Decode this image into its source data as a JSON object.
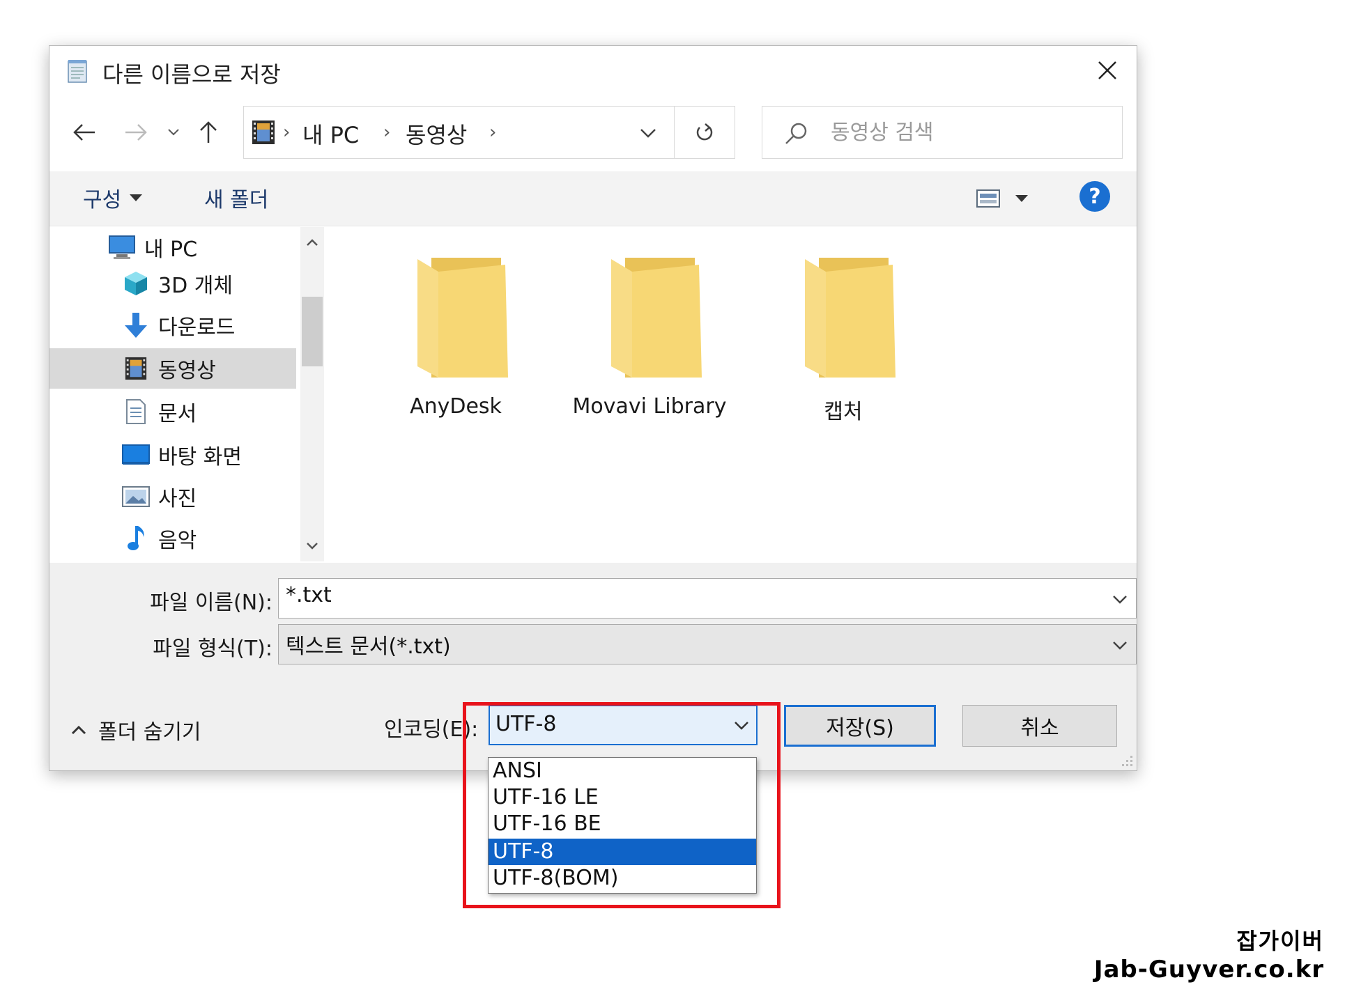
{
  "window": {
    "title": "다른 이름으로 저장"
  },
  "nav": {
    "breadcrumb": [
      "내 PC",
      "동영상"
    ],
    "search_placeholder": "동영상 검색"
  },
  "toolbar": {
    "organize": "구성",
    "new_folder": "새 폴더",
    "help": "?"
  },
  "navpane": {
    "items": [
      {
        "label": "내 PC",
        "icon": "computer-icon"
      },
      {
        "label": "3D 개체",
        "icon": "cube-3d-icon"
      },
      {
        "label": "다운로드",
        "icon": "download-arrow-icon"
      },
      {
        "label": "동영상",
        "icon": "film-icon",
        "selected": true
      },
      {
        "label": "문서",
        "icon": "document-icon"
      },
      {
        "label": "바탕 화면",
        "icon": "desktop-icon"
      },
      {
        "label": "사진",
        "icon": "picture-icon"
      },
      {
        "label": "음악",
        "icon": "music-note-icon"
      }
    ]
  },
  "folders": [
    {
      "name": "AnyDesk"
    },
    {
      "name": "Movavi Library"
    },
    {
      "name": "캡처"
    }
  ],
  "form": {
    "filename_label": "파일 이름(N):",
    "filename_value": "*.txt",
    "filetype_label": "파일 형식(T):",
    "filetype_value": "텍스트 문서(*.txt)",
    "hide_folders": "폴더 숨기기",
    "encoding_label": "인코딩(E):",
    "encoding_value": "UTF-8",
    "save": "저장(S)",
    "cancel": "취소"
  },
  "encoding_options": [
    {
      "label": "ANSI"
    },
    {
      "label": "UTF-16 LE"
    },
    {
      "label": "UTF-16 BE"
    },
    {
      "label": "UTF-8",
      "selected": true
    },
    {
      "label": "UTF-8(BOM)"
    }
  ],
  "watermark": {
    "line1": "잡가이버",
    "line2": "Jab-Guyver.co.kr"
  },
  "colors": {
    "accent": "#1a6fd1",
    "selection": "#0f63c7",
    "highlight": "#e8131b",
    "folder": "#f7d774"
  }
}
